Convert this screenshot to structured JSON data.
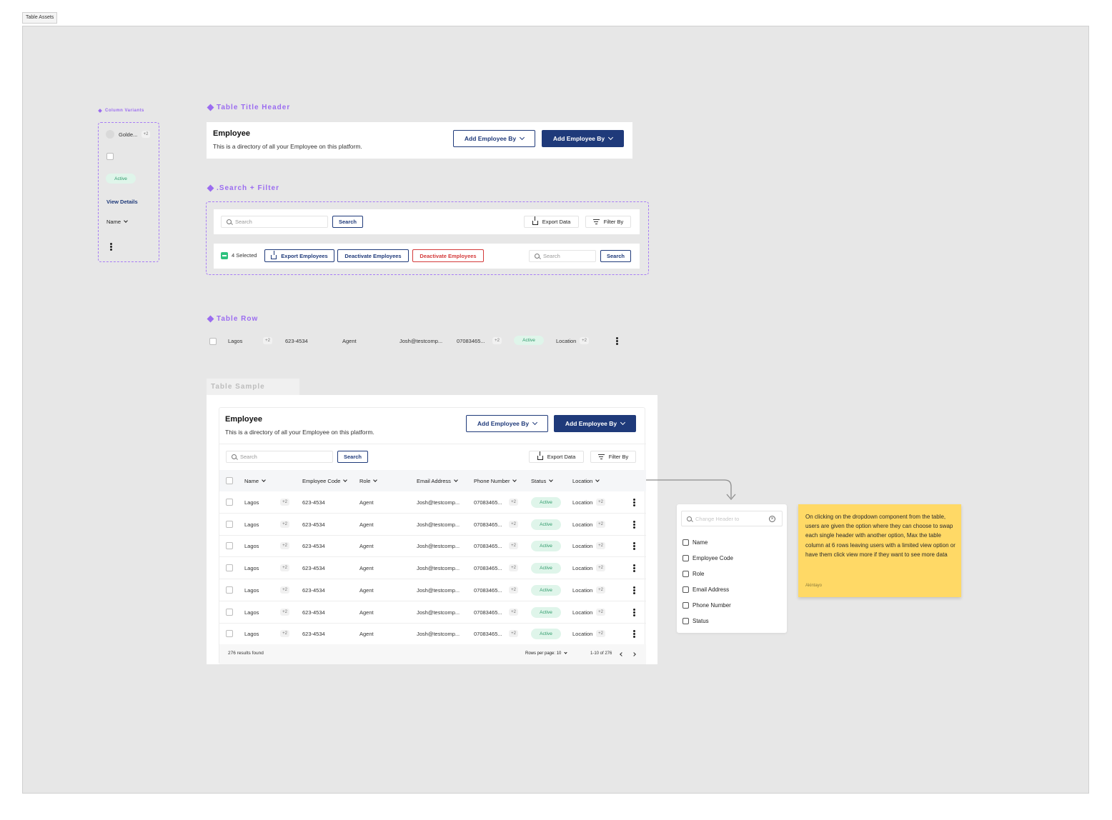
{
  "frame_tag": "Table Assets",
  "column_variants": {
    "label": "Column Variants",
    "avatar_name": "Golde...",
    "plus": "+2",
    "status": "Active",
    "view_details": "View Details",
    "header_name": "Name"
  },
  "table_title_header": {
    "label": "Table Title Header",
    "title": "Employee",
    "subtitle": "This is a directory of all your Employee on this platform.",
    "btn_outline": "Add Employee By",
    "btn_solid": "Add Employee By"
  },
  "search_filter": {
    "label": ".Search + Filter",
    "search_placeholder": "Search",
    "search_button": "Search",
    "export_label": "Export Data",
    "filter_label": "Filter By",
    "selected_count": "4 Selected",
    "export_employees": "Export Employees",
    "deactivate_employees": "Deactivate Employees",
    "deactivate_employees_red": "Deactivate Employees",
    "search_placeholder_2": "Search",
    "search_button_2": "Search"
  },
  "table_row": {
    "label": "Table Row",
    "location": "Lagos",
    "plus_a": "+2",
    "code": "623-4534",
    "role": "Agent",
    "email": "Josh@testcomp...",
    "phone": "07083465...",
    "plus_b": "+2",
    "status": "Active",
    "location2": "Location",
    "plus_c": "+2"
  },
  "table_sample": {
    "label": "Table Sample",
    "title": "Employee",
    "subtitle": "This is a directory of all your Employee on this platform.",
    "btn_outline": "Add Employee By",
    "btn_solid": "Add Employee By",
    "search_placeholder": "Search",
    "search_button": "Search",
    "export_label": "Export Data",
    "filter_label": "Filter By",
    "columns": [
      "Name",
      "Employee Code",
      "Role",
      "Email Address",
      "Phone Number",
      "Status",
      "Location"
    ],
    "rows": [
      {
        "name": "Lagos",
        "p1": "+2",
        "code": "623-4534",
        "role": "Agent",
        "email": "Josh@testcomp...",
        "phone": "07083465...",
        "p2": "+2",
        "status": "Active",
        "location": "Location",
        "p3": "+2"
      },
      {
        "name": "Lagos",
        "p1": "+2",
        "code": "623-4534",
        "role": "Agent",
        "email": "Josh@testcomp...",
        "phone": "07083465...",
        "p2": "+2",
        "status": "Active",
        "location": "Location",
        "p3": "+2"
      },
      {
        "name": "Lagos",
        "p1": "+2",
        "code": "623-4534",
        "role": "Agent",
        "email": "Josh@testcomp...",
        "phone": "07083465...",
        "p2": "+2",
        "status": "Active",
        "location": "Location",
        "p3": "+2"
      },
      {
        "name": "Lagos",
        "p1": "+2",
        "code": "623-4534",
        "role": "Agent",
        "email": "Josh@testcomp...",
        "phone": "07083465...",
        "p2": "+2",
        "status": "Active",
        "location": "Location",
        "p3": "+2"
      },
      {
        "name": "Lagos",
        "p1": "+2",
        "code": "623-4534",
        "role": "Agent",
        "email": "Josh@testcomp...",
        "phone": "07083465...",
        "p2": "+2",
        "status": "Active",
        "location": "Location",
        "p3": "+2"
      },
      {
        "name": "Lagos",
        "p1": "+2",
        "code": "623-4534",
        "role": "Agent",
        "email": "Josh@testcomp...",
        "phone": "07083465...",
        "p2": "+2",
        "status": "Active",
        "location": "Location",
        "p3": "+2"
      },
      {
        "name": "Lagos",
        "p1": "+2",
        "code": "623-4534",
        "role": "Agent",
        "email": "Josh@testcomp...",
        "phone": "07083465...",
        "p2": "+2",
        "status": "Active",
        "location": "Location",
        "p3": "+2"
      }
    ],
    "results": "276 results found",
    "rows_per_page": "Rows per page: 10",
    "range": "1-10 of 276"
  },
  "header_dropdown": {
    "placeholder": "Change Header to",
    "options": [
      "Name",
      "Employee Code",
      "Role",
      "Email Address",
      "Phone Number",
      "Status"
    ]
  },
  "sticky_note": {
    "text": "On clicking on the dropdown component from the table, users are given the option where they can choose to swap each single header with another option, Max the table column at 6 rows leaving users with a limited view option or have them click view more if they want to see more data",
    "author": "Akintayo"
  },
  "colors": {
    "accent_purple": "#9b6cf0",
    "primary_navy": "#1f3a7a",
    "danger_red": "#d43a3a",
    "active_green": "#2e9a6a",
    "sticky_yellow": "#ffd966",
    "canvas_grey": "#e7e7e7"
  },
  "icons": [
    "search-icon",
    "chevron-down-icon",
    "export-icon",
    "filter-icon",
    "kebab-icon",
    "clear-icon",
    "chevron-left-icon",
    "chevron-right-icon",
    "diamond-icon"
  ]
}
